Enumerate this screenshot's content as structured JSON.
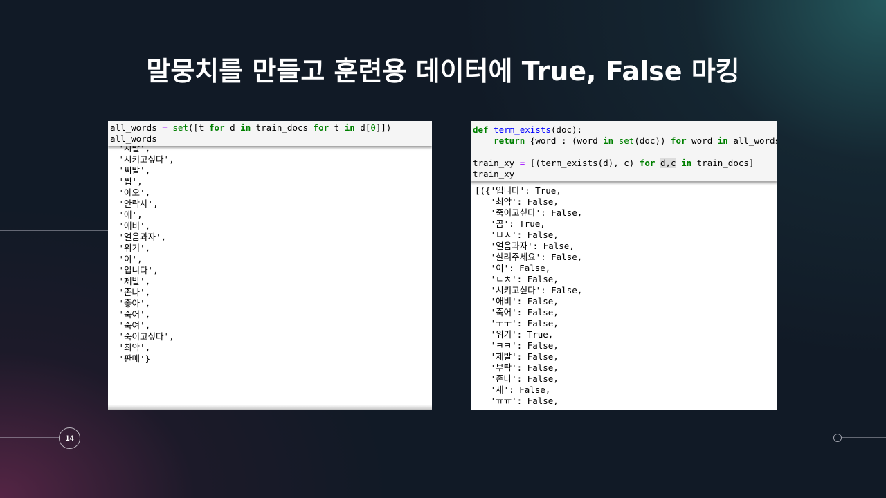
{
  "slide": {
    "title": "말뭉치를 만들고 훈련용 데이터에 True, False 마킹",
    "page_number": "14"
  },
  "left_panel": {
    "code_lines": [
      "all_words = set([t for d in train_docs for t in d[0]])",
      "all_words"
    ],
    "output_lines": [
      " '시발',",
      " '시키고싶다',",
      " '씨발',",
      " '씹',",
      " '아오',",
      " '안락사',",
      " '애',",
      " '애비',",
      " '얼음과자',",
      " '위기',",
      " '이',",
      " '입니다',",
      " '제발',",
      " '존나',",
      " '좋아',",
      " '죽어',",
      " '죽여',",
      " '죽이고싶다',",
      " '최악',",
      " '판매'}"
    ]
  },
  "right_panel": {
    "code_lines": [
      "def term_exists(doc):",
      "    return {word : (word in set(doc)) for word in all_words}",
      "",
      "train_xy = [(term_exists(d), c) for d,c in train_docs]",
      "train_xy"
    ],
    "output_lines": [
      "[({'입니다': True,",
      "   '최악': False,",
      "   '죽이고싶다': False,",
      "   '곰': True,",
      "   'ㅂㅅ': False,",
      "   '얼음과자': False,",
      "   '살려주세요': False,",
      "   '이': False,",
      "   'ㄷㅊ': False,",
      "   '시키고싶다': False,",
      "   '애비': False,",
      "   '죽어': False,",
      "   'ㅜㅜ': False,",
      "   '위기': True,",
      "   'ㅋㅋ': False,",
      "   '제발': False,",
      "   '부탁': False,",
      "   '존나': False,",
      "   '새': False,",
      "   'ㅠㅠ': False,"
    ]
  }
}
